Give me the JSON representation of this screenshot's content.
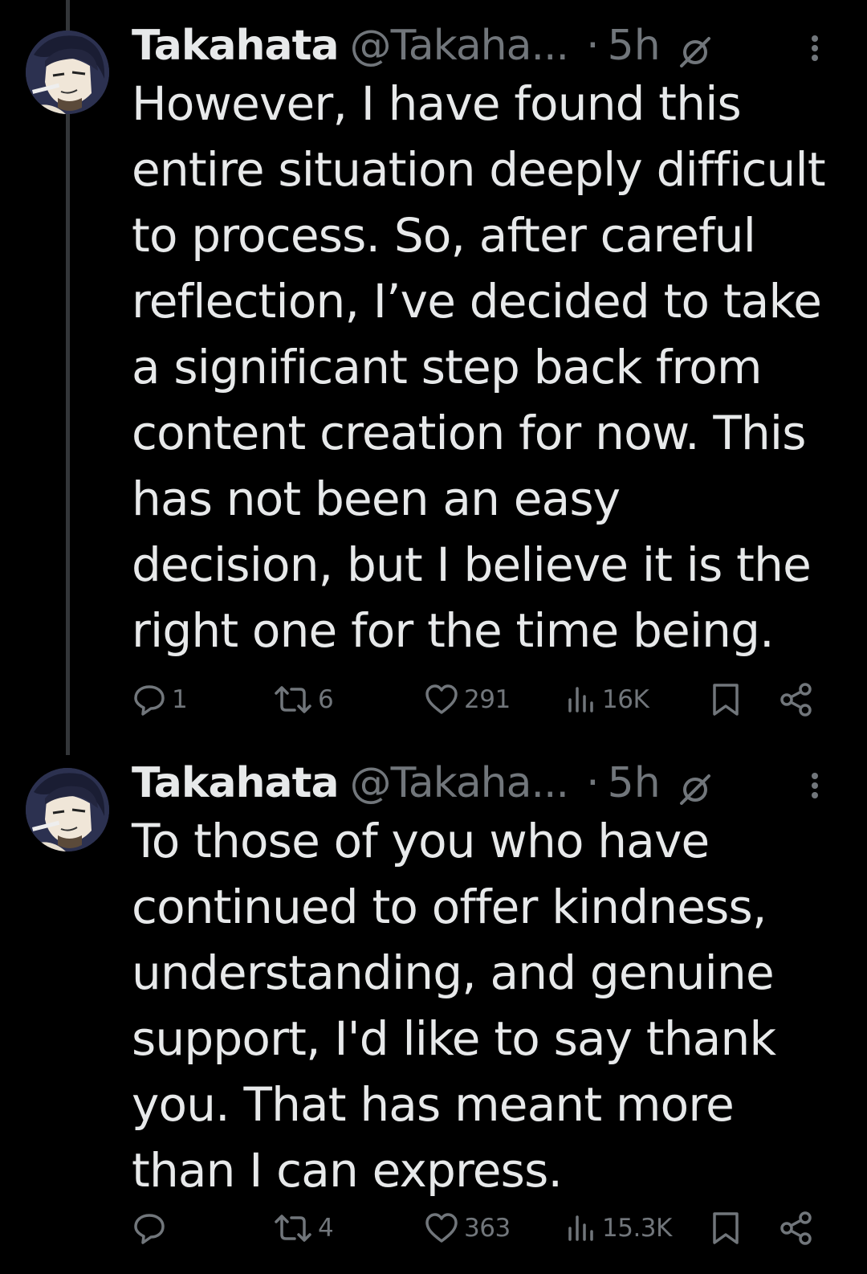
{
  "colors": {
    "background": "#000000",
    "text": "#e7e9ea",
    "secondary": "#71767b",
    "thread_line": "#333639"
  },
  "tweets": [
    {
      "author": {
        "display_name": "Takahata",
        "handle": "@Takaha...",
        "avatar_icon": "avatar"
      },
      "separator": "·",
      "time": "5h",
      "icons": {
        "muted": "muted-icon",
        "more": "more-icon"
      },
      "lines": [
        "However, I have found this",
        "entire situation deeply difficult",
        "to process. So, after careful",
        "reflection, I’ve decided to take",
        "a significant step back from",
        "content creation for now. This",
        "has not been an easy",
        "decision, but I believe it is the",
        "right one for the time being."
      ],
      "stats": {
        "replies": "1",
        "reposts": "6",
        "likes": "291",
        "views": "16K"
      }
    },
    {
      "author": {
        "display_name": "Takahata",
        "handle": "@Takaha...",
        "avatar_icon": "avatar"
      },
      "separator": "·",
      "time": "5h",
      "icons": {
        "muted": "muted-icon",
        "more": "more-icon"
      },
      "lines": [
        "To those of you who have",
        "continued to offer kindness,",
        "understanding, and genuine",
        "support, I'd like to say thank",
        "you. That has meant more",
        "than I can express."
      ],
      "stats": {
        "replies": "",
        "reposts": "4",
        "likes": "363",
        "views": "15.3K"
      }
    }
  ]
}
